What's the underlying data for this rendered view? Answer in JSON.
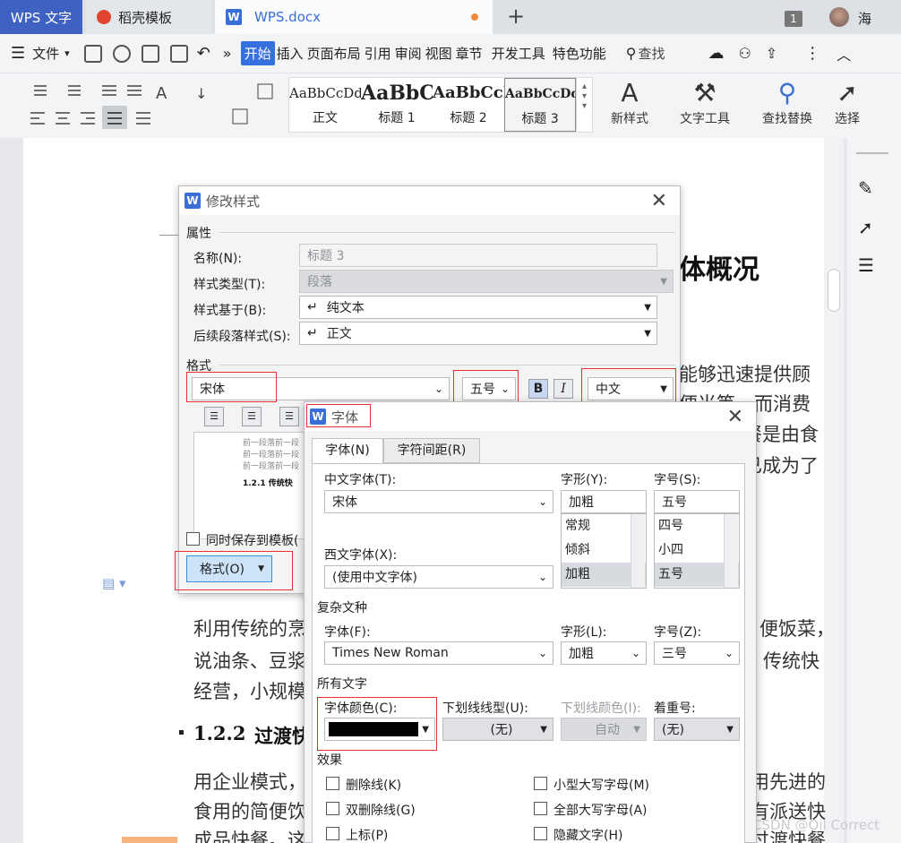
{
  "tabs": {
    "app": "WPS 文字",
    "template": "稻壳模板",
    "doc": "WPS.docx",
    "user": "海",
    "count": "1"
  },
  "menu": {
    "file": "文件",
    "items": [
      "开始",
      "插入",
      "页面布局",
      "引用",
      "审阅",
      "视图",
      "章节",
      "开发工具",
      "特色功能"
    ],
    "search": "查找"
  },
  "ribbon": {
    "styles": [
      {
        "preview": "AaBbCcDd",
        "label": "正文"
      },
      {
        "preview": "AaBbCc",
        "label": "标题 1"
      },
      {
        "preview": "AaBbCcI",
        "label": "标题 2"
      },
      {
        "preview": "AaBbCcDd",
        "label": "标题 3"
      }
    ],
    "new_style": "新样式",
    "text_tools": "文字工具",
    "find_replace": "查找替换",
    "select": "选择"
  },
  "doc": {
    "heading_frag": "体概况",
    "p1_lines": [
      "能够迅速提供顾",
      "便当等。而消费",
      "餐是由食",
      "已成为了"
    ],
    "p2": [
      "利用传统的烹",
      "说油条、豆浆",
      "经营，小规模"
    ],
    "p2_right": [
      "便饭菜，",
      "传统快"
    ],
    "h122_num": "1.2.2",
    "h122": "过渡快",
    "p3": [
      "用企业模式，",
      "食用的简便饮",
      "成品快餐。这"
    ],
    "p3_right": [
      "用先进的",
      "有派送快",
      "过渡快餐"
    ],
    "watermark": "CSDN @Oil Correct"
  },
  "dlg1": {
    "title": "修改样式",
    "props": "属性",
    "name_lbl": "名称(N):",
    "name_val": "标题 3",
    "type_lbl": "样式类型(T):",
    "type_val": "段落",
    "based_lbl": "样式基于(B):",
    "based_val": "纯文本",
    "next_lbl": "后续段落样式(S):",
    "next_val": "正文",
    "format_lbl": "格式",
    "font_val": "宋体",
    "size_val": "五号",
    "bold": "B",
    "italic": "I",
    "lang_val": "中文",
    "preview_lines": [
      "前一段落前一段",
      "前一段落前一段",
      "前一段落前一段"
    ],
    "preview_head": "1.2.1 传统快",
    "save_tpl": "同时保存到模板(",
    "format_btn": "格式(O)"
  },
  "dlg2": {
    "title": "字体",
    "tab_font": "字体(N)",
    "tab_spacing": "字符间距(R)",
    "cn_font_lbl": "中文字体(T):",
    "cn_font": "宋体",
    "style_lbl": "字形(Y):",
    "style_val": "加粗",
    "style_list": [
      "常规",
      "倾斜",
      "加粗"
    ],
    "size_lbl": "字号(S):",
    "size_val": "五号",
    "size_list": [
      "四号",
      "小四",
      "五号"
    ],
    "west_lbl": "西文字体(X):",
    "west_val": "(使用中文字体)",
    "complex_grp": "复杂文种",
    "cx_font_lbl": "字体(F):",
    "cx_font": "Times New Roman",
    "cx_style_lbl": "字形(L):",
    "cx_style": "加粗",
    "cx_size_lbl": "字号(Z):",
    "cx_size": "三号",
    "all_grp": "所有文字",
    "color_lbl": "字体颜色(C):",
    "underline_lbl": "下划线线型(U):",
    "underline_val": "(无)",
    "ucolor_lbl": "下划线颜色(I):",
    "ucolor_val": "自动",
    "emph_lbl": "着重号:",
    "emph_val": "(无)",
    "effects_grp": "效果",
    "effects": [
      "删除线(K)",
      "双删除线(G)",
      "上标(P)",
      "小型大写字母(M)",
      "全部大写字母(A)",
      "隐藏文字(H)"
    ],
    "font_color": "#000000"
  }
}
